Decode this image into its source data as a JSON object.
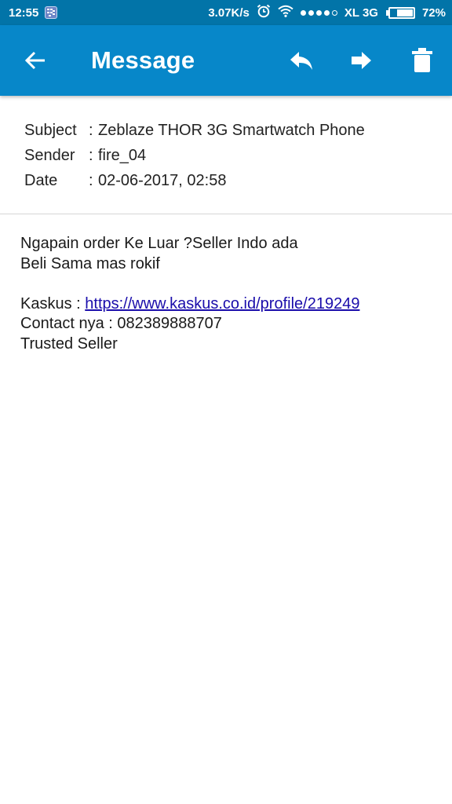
{
  "status_bar": {
    "time": "12:55",
    "speed": "3.07K/s",
    "carrier": "XL 3G",
    "battery": "72%",
    "battery_level": 0.72,
    "icons": [
      "bbm-icon",
      "alarm-icon",
      "wifi-icon",
      "signal-icon",
      "battery-icon"
    ]
  },
  "app_bar": {
    "title": "Message",
    "background": "#0787c9",
    "actions": [
      "back-arrow-icon",
      "reply-icon",
      "forward-icon",
      "trash-icon"
    ]
  },
  "meta": {
    "subject_label": "Subject",
    "subject_value": "Zeblaze THOR 3G Smartwatch Phone",
    "sender_label": "Sender",
    "sender_value": "fire_04",
    "date_label": "Date",
    "date_value": "02-06-2017, 02:58",
    "separator": ":"
  },
  "body": {
    "line1": "Ngapain order Ke Luar ?Seller Indo ada",
    "line2": "Beli Sama mas rokif",
    "kaskus_label": "Kaskus : ",
    "kaskus_link": "https://www.kaskus.co.id/profile/219249",
    "contact": "Contact nya : 082389888707",
    "trusted": "Trusted Seller"
  }
}
